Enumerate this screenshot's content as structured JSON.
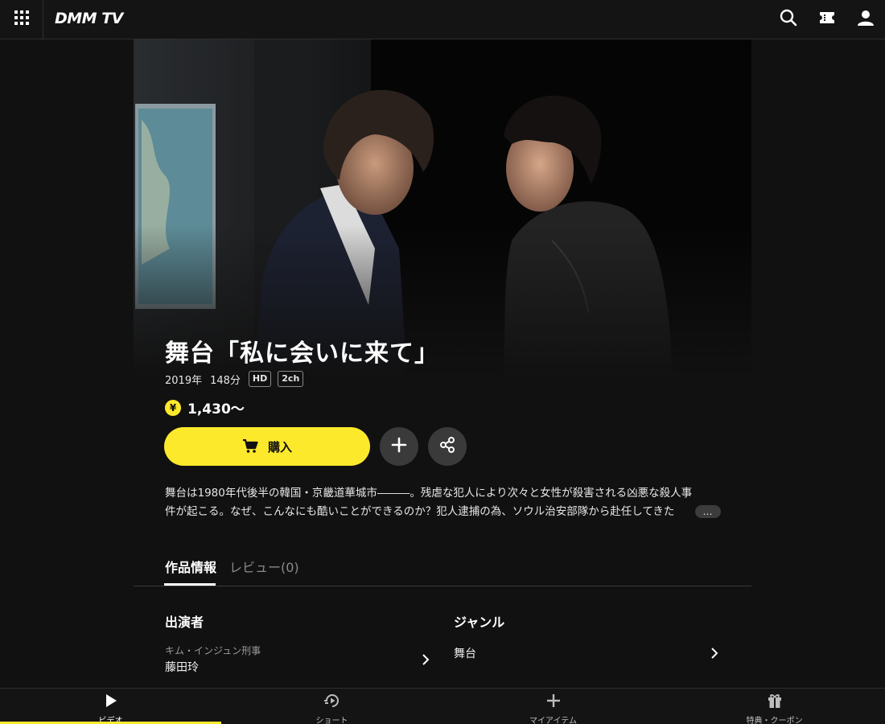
{
  "header": {
    "logo": "DMM TV",
    "icons": [
      "apps-grid-icon",
      "search-icon",
      "ticket-icon",
      "user-icon"
    ]
  },
  "title": {
    "main": "舞台「私に会いに来て」"
  },
  "meta": {
    "year": "2019年",
    "duration": "148分",
    "badges": [
      "HD",
      "2ch"
    ]
  },
  "price": {
    "symbol": "¥",
    "amount": "1,430〜"
  },
  "actions": {
    "buy_label": "購入",
    "add_icon": "plus-icon",
    "share_icon": "share-icon"
  },
  "description": {
    "line1": "舞台は1980年代後半の韓国・京畿道華城市―――。残虐な犯人により次々と女性が殺害される凶悪な殺人事",
    "line2": "件が起こる。なぜ、こんなにも酷いことができるのか？犯人逮捕の為、ソウル治安部隊から赴任してきた",
    "more_label": "…"
  },
  "tabs": [
    {
      "label": "作品情報",
      "active": true
    },
    {
      "label": "レビュー(0)",
      "active": false
    }
  ],
  "cast": {
    "heading": "出演者",
    "items": [
      {
        "role": "キム・インジュン刑事",
        "name": "藤田玲"
      }
    ]
  },
  "genre": {
    "heading": "ジャンル",
    "items": [
      {
        "label": "舞台"
      }
    ]
  },
  "bottom_nav": [
    {
      "label": "ビデオ",
      "icon": "play-icon",
      "active": true
    },
    {
      "label": "ショート",
      "icon": "short-play-icon",
      "active": false
    },
    {
      "label": "マイアイテム",
      "icon": "plus-icon",
      "active": false
    },
    {
      "label": "特典・クーポン",
      "icon": "gift-icon",
      "active": false
    }
  ],
  "colors": {
    "accent": "#fde92b",
    "background": "#111111",
    "panel": "#141414"
  }
}
